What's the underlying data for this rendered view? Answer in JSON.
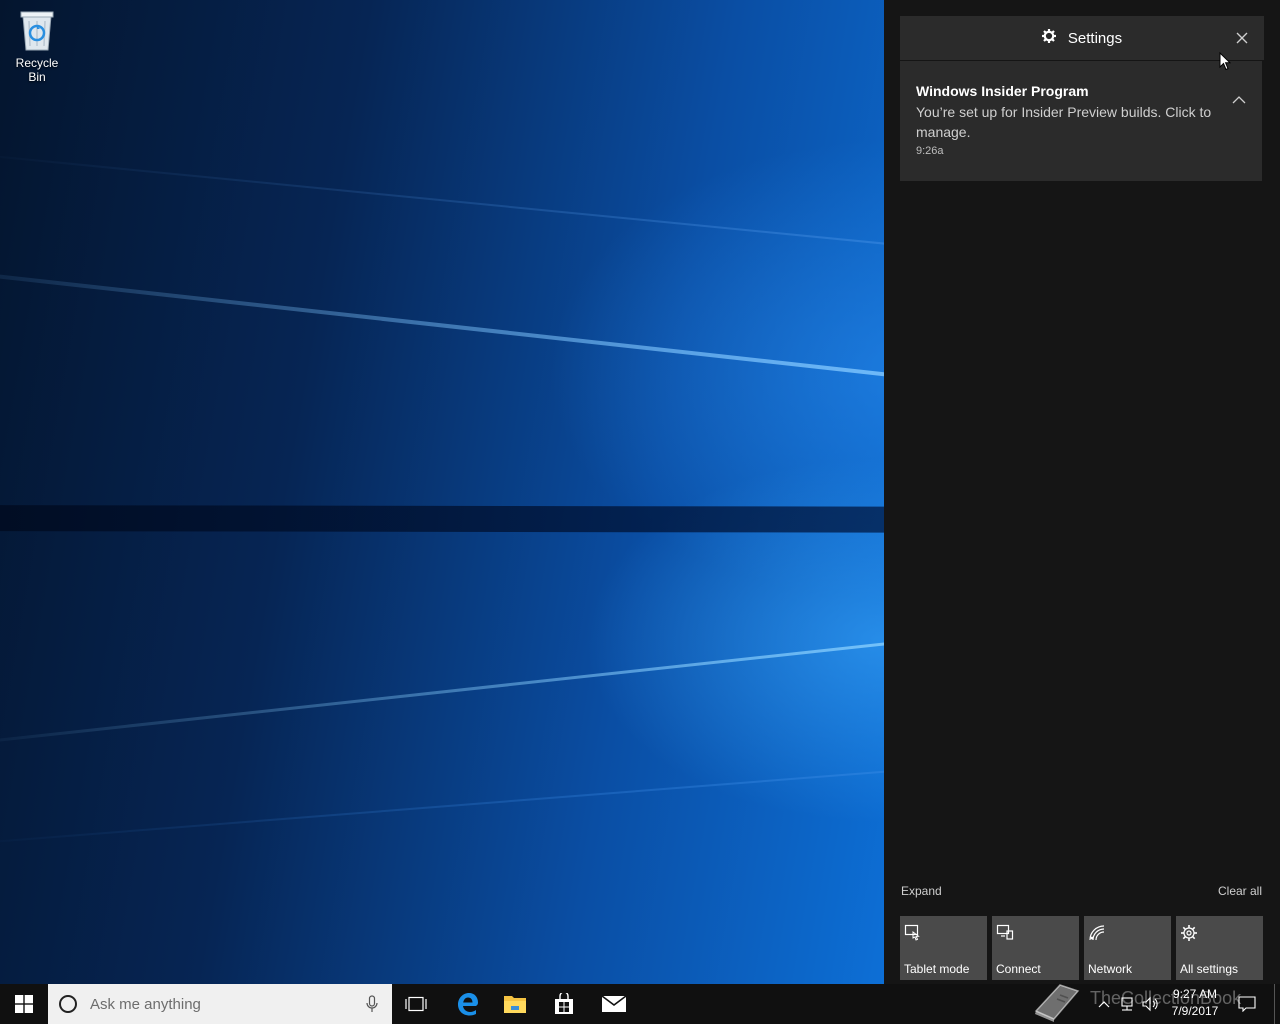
{
  "desktop": {
    "icons": [
      {
        "label": "Recycle Bin",
        "icon": "recycle-bin-icon"
      }
    ]
  },
  "action_center": {
    "header": {
      "title": "Settings",
      "icon": "gear-icon",
      "close_icon": "close-icon"
    },
    "notifications": [
      {
        "title": "Windows Insider Program",
        "body": "You’re set up for Insider Preview builds. Click to manage.",
        "time": "9:26a",
        "collapse_icon": "chevron-up-icon"
      }
    ],
    "expand_label": "Expand",
    "clear_all_label": "Clear all",
    "quick_actions": [
      {
        "label": "Tablet mode",
        "icon": "tablet-mode-icon"
      },
      {
        "label": "Connect",
        "icon": "connect-icon"
      },
      {
        "label": "Network",
        "icon": "network-icon"
      },
      {
        "label": "All settings",
        "icon": "gear-icon"
      }
    ]
  },
  "taskbar": {
    "search_placeholder": "Ask me anything",
    "pinned": [
      "task-view-icon",
      "edge-icon",
      "file-explorer-icon",
      "store-icon",
      "mail-icon"
    ],
    "clock": {
      "time": "9:27 AM",
      "date": "7/9/2017"
    }
  },
  "watermark": "TheCollectionBook",
  "colors": {
    "action_center_bg": "#151515",
    "card_bg": "#2b2b2b",
    "tile_bg": "#4a4a4a",
    "taskbar_bg": "#101010",
    "accent": "#0078d7"
  }
}
